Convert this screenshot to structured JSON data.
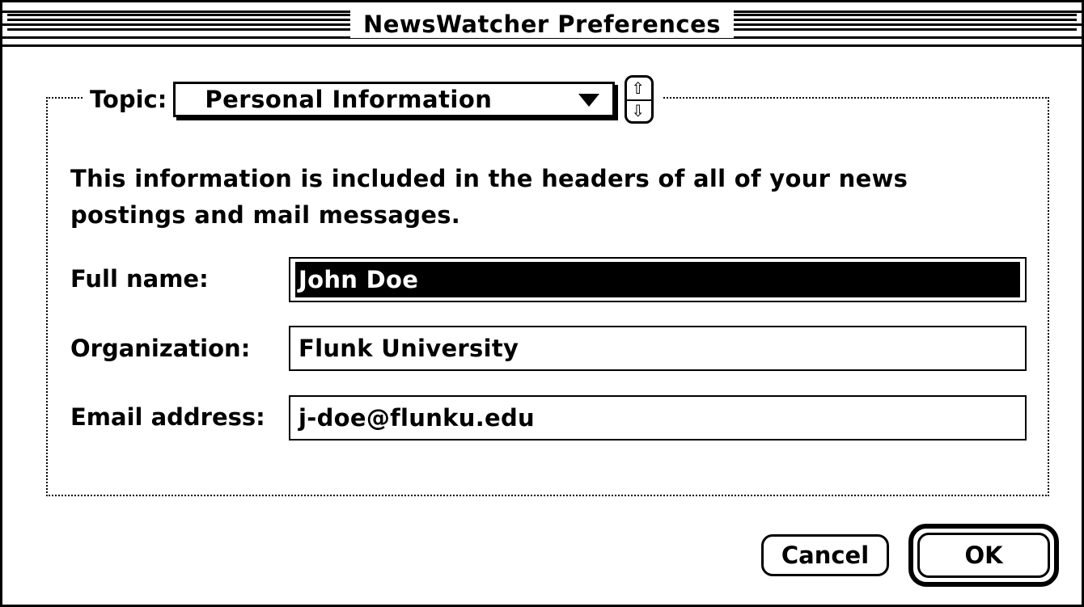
{
  "window": {
    "title": "NewsWatcher Preferences"
  },
  "topic": {
    "label": "Topic:",
    "value": "Personal Information"
  },
  "description": "This information is included in the headers of all of your news postings and mail messages.",
  "fields": {
    "full_name": {
      "label": "Full name:",
      "value": "John Doe"
    },
    "organization": {
      "label": "Organization:",
      "value": "Flunk University"
    },
    "email": {
      "label": "Email address:",
      "value": "j-doe@flunku.edu"
    }
  },
  "buttons": {
    "cancel": "Cancel",
    "ok": "OK"
  }
}
